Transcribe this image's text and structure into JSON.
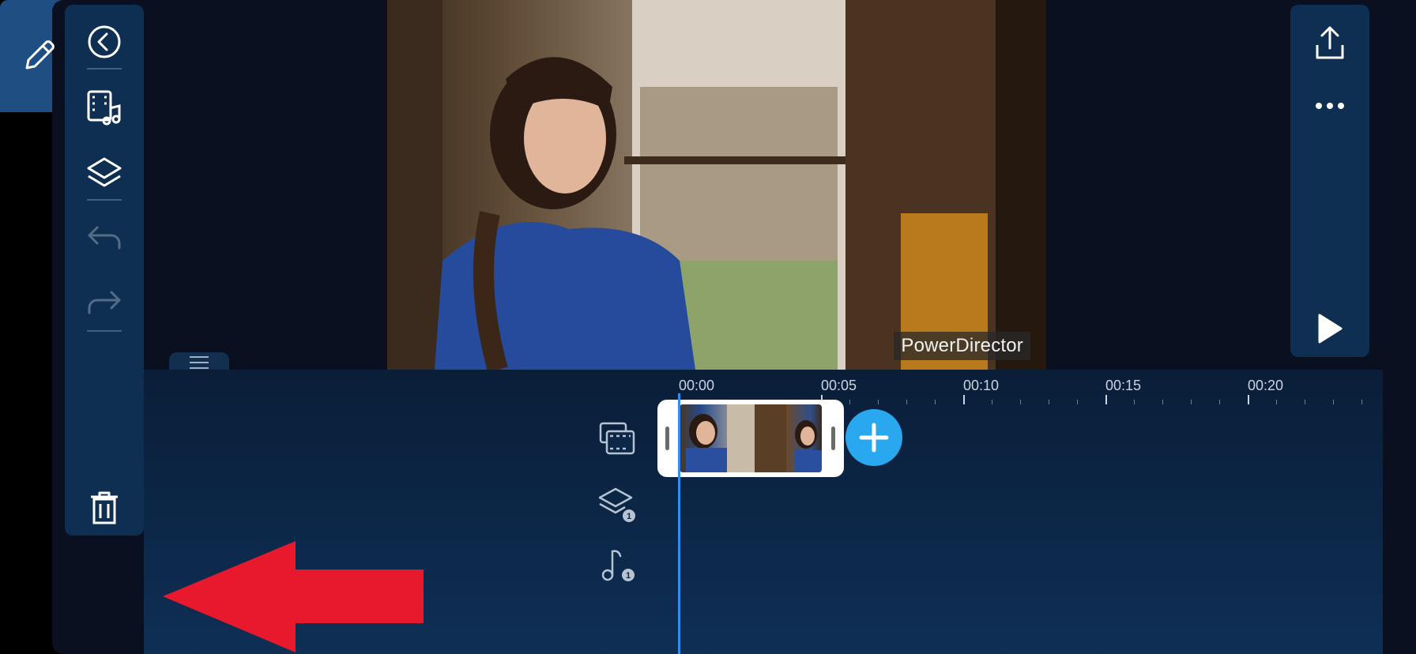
{
  "left_toolbar": {
    "items": [
      {
        "name": "back",
        "icon": "back-circle-icon",
        "enabled": true
      },
      {
        "name": "media-library",
        "icon": "media-music-icon",
        "enabled": true
      },
      {
        "name": "layers",
        "icon": "layers-icon",
        "enabled": true
      },
      {
        "name": "undo",
        "icon": "undo-icon",
        "enabled": false
      },
      {
        "name": "redo",
        "icon": "redo-icon",
        "enabled": false
      },
      {
        "name": "delete",
        "icon": "trash-icon",
        "enabled": true
      }
    ],
    "edit_button": {
      "icon": "pencil-icon",
      "active": true
    }
  },
  "right_toolbar": {
    "items": [
      {
        "name": "export",
        "icon": "share-upload-icon"
      },
      {
        "name": "more",
        "icon": "more-horizontal-icon"
      },
      {
        "name": "play",
        "icon": "play-icon"
      }
    ]
  },
  "preview": {
    "watermark": "PowerDirector"
  },
  "timeline": {
    "ticks": [
      "00:00",
      "00:05",
      "00:10",
      "00:15",
      "00:20"
    ],
    "tracks": [
      {
        "name": "video-track",
        "icon": "video-track-icon",
        "badge": ""
      },
      {
        "name": "overlay-track",
        "icon": "layers-track-icon",
        "badge": "1"
      },
      {
        "name": "audio-track",
        "icon": "music-note-icon",
        "badge": "1"
      }
    ],
    "add_button_icon": "plus-icon"
  },
  "annotation": {
    "icon": "red-arrow-pointing-left",
    "color": "#e8192c"
  },
  "colors": {
    "accent": "#29a8ef",
    "playhead": "#2f8ef0",
    "panel": "#0e2f52",
    "edit_active": "#1f4e82"
  }
}
